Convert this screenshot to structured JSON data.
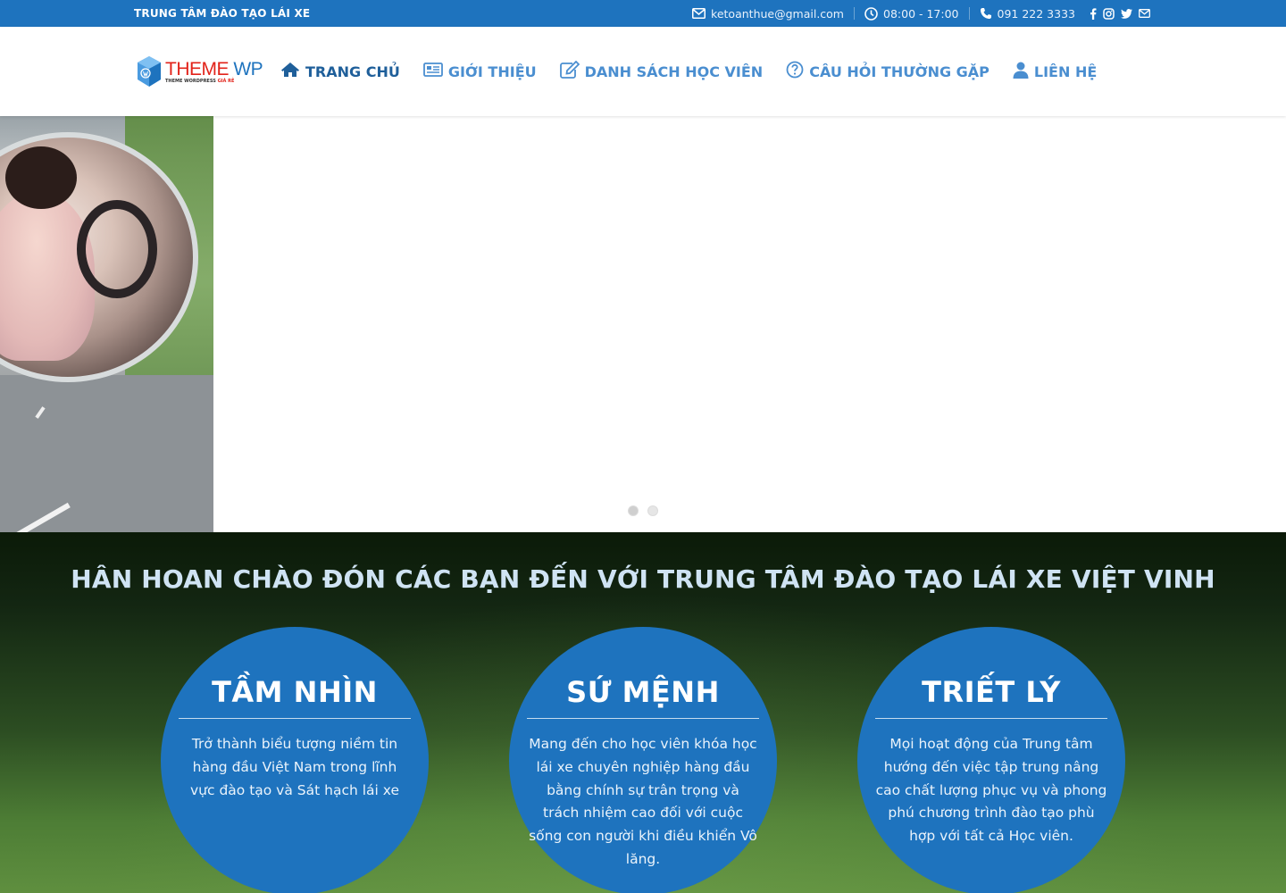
{
  "topbar": {
    "brand": "TRUNG TÂM ĐÀO TẠO LÁI XE",
    "email": "ketoanthue@gmail.com",
    "hours": "08:00 - 17:00",
    "phone": "091 222 3333",
    "email_icon": "envelope-icon",
    "hours_icon": "clock-icon",
    "phone_icon": "phone-icon",
    "social_icons": [
      "facebook-icon",
      "instagram-icon",
      "twitter-icon",
      "mail-icon"
    ]
  },
  "header": {
    "logo": {
      "text_red": "THEME",
      "text_blue": "WP",
      "tagline_prefix": "THEME WORDPRESS",
      "tagline_suffix": "GIÁ RẺ"
    },
    "nav": [
      {
        "label": "TRANG CHỦ",
        "icon": "home-icon",
        "active": true
      },
      {
        "label": "GIỚI THIỆU",
        "icon": "newspaper-icon",
        "active": false
      },
      {
        "label": "DANH SÁCH HỌC VIÊN",
        "icon": "edit-icon",
        "active": false
      },
      {
        "label": "CÂU HỎI THƯỜNG GẶP",
        "icon": "question-circle-icon",
        "active": false
      },
      {
        "label": "LIÊN HỆ",
        "icon": "user-icon",
        "active": false
      }
    ]
  },
  "slider": {
    "dot_count": 2,
    "active_dot": 0
  },
  "welcome": {
    "heading": "HÂN HOAN CHÀO ĐÓN CÁC BẠN ĐẾN VỚI TRUNG TÂM ĐÀO TẠO LÁI XE VIỆT VINH",
    "cards": [
      {
        "title": "TẦM NHÌN",
        "body": "Trở thành biểu tượng niềm tin hàng đầu Việt Nam trong lĩnh vực đào tạo và Sát hạch lái xe"
      },
      {
        "title": "SỨ MỆNH",
        "body": "Mang đến cho học viên khóa học lái xe chuyên nghiệp hàng đầu bằng chính sự trân trọng và trách nhiệm cao đối với cuộc sống con người khi điều khiển Vô lăng."
      },
      {
        "title": "TRIẾT LÝ",
        "body": "Mọi hoạt động của Trung tâm hướng đến việc tập trung nâng cao chất lượng phục vụ và phong phú chương trình đào tạo phù hợp với tất cả Học viên."
      }
    ]
  },
  "colors": {
    "primary": "#1e73be",
    "nav_text": "#4a8ed0",
    "nav_active": "#1f5f9a",
    "logo_red": "#e2231a"
  }
}
